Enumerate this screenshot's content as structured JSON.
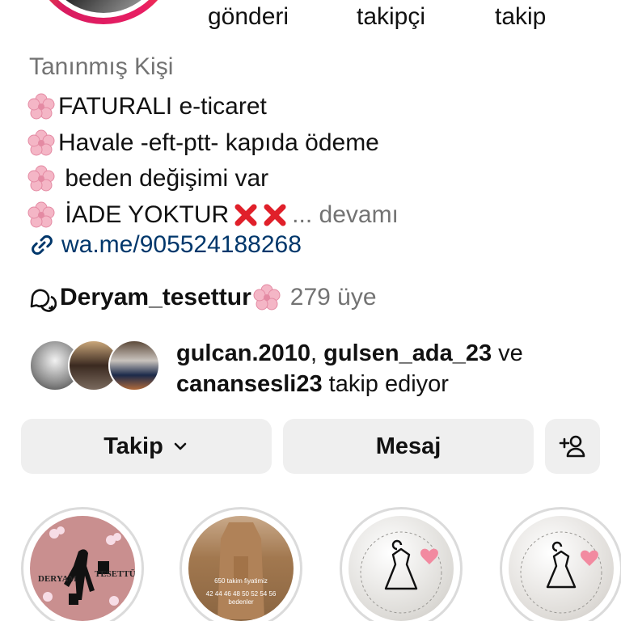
{
  "stats": {
    "posts_label": "gönderi",
    "followers_label": "takipçi",
    "following_label": "takip"
  },
  "profile": {
    "category": "Tanınmış Kişi",
    "bio_lines": [
      "FATURALI e-ticaret",
      "Havale -eft-ptt- kapıda ödeme",
      " beden değişimi var",
      " İADE YOKTUR"
    ],
    "more_label": "... devamı",
    "link": "wa.me/905524188268",
    "line_icons": [
      "cherry-blossom-icon",
      "cherry-blossom-icon",
      "cherry-blossom-icon",
      "cherry-blossom-icon"
    ]
  },
  "channel": {
    "name": "Deryam_tesettur",
    "members": "279 üye",
    "icon": "broadcast-chat-icon"
  },
  "followed_by": {
    "user1": "gulcan.2010",
    "sep1": ", ",
    "user2": "gulsen_ada_23",
    "and": " ve",
    "user3": "canansesli23",
    "suffix": " takip ediyor"
  },
  "actions": {
    "follow_label": "Takip",
    "message_label": "Mesaj",
    "suggest_icon": "add-person-icon"
  },
  "highlights": {
    "h1_text_left": "DERYAM",
    "h1_text_right": "TESETTÜR",
    "h2_price_line1": "650 takim fiyatimiz",
    "h2_price_line2": "42 44 46 48 50 52 54 56",
    "h2_price_line3": "bedenler"
  },
  "colors": {
    "link": "#00376b",
    "secondary_text": "#737373",
    "button_bg": "#efefef",
    "x_mark": "#e0202a",
    "blossom": "#f4b6c6"
  }
}
